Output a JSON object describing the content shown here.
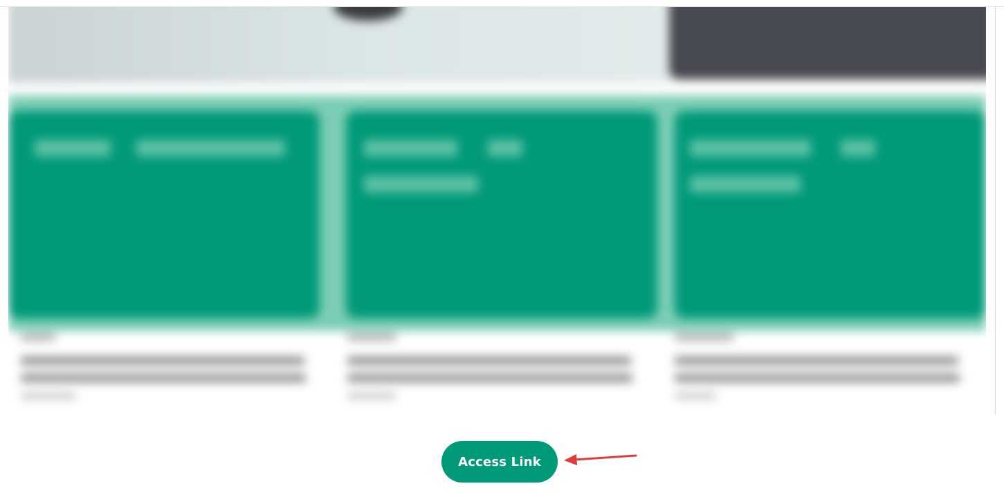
{
  "action": {
    "button_label": "Access Link",
    "button_color": "#009a78",
    "button_text_color": "#ffffff"
  },
  "annotation": {
    "arrow_color": "#e03c3c",
    "arrow_target": "access-link-button"
  },
  "preview": {
    "state": "blurred",
    "card_count": 3,
    "card_color": "#009a78",
    "band_color": "#7ccdb6",
    "dark_banner_color": "#474a51"
  }
}
